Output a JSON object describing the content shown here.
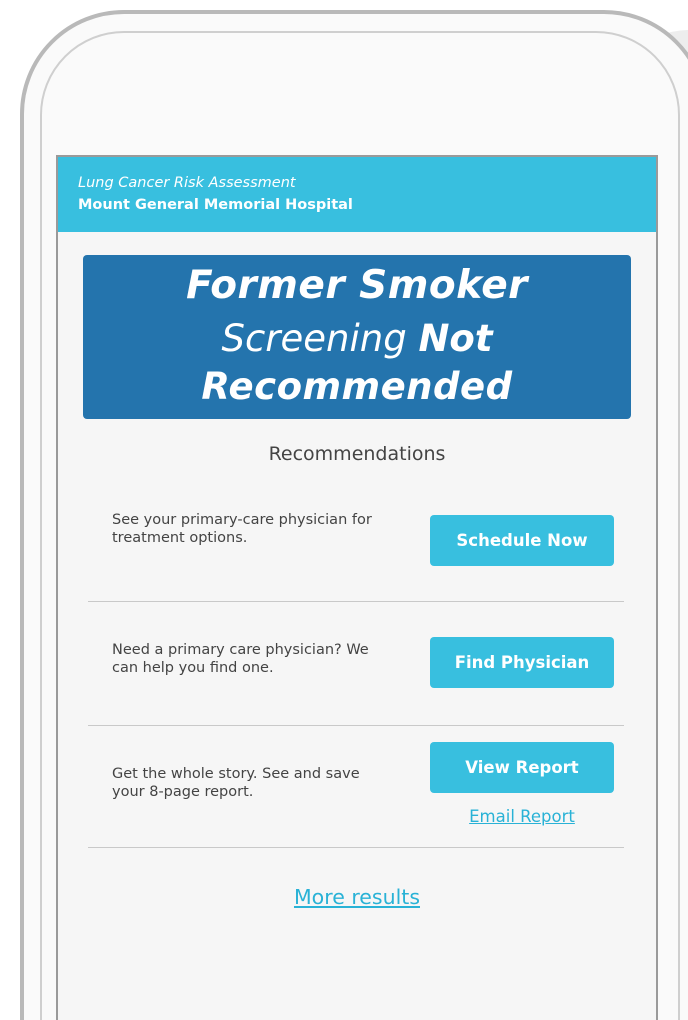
{
  "header": {
    "subtitle": "Lung Cancer Risk Assessment",
    "hospital": "Mount General Memorial Hospital"
  },
  "result": {
    "status": "Former Smoker",
    "line2_part1": "Screening",
    "line2_part2": "Not",
    "line3": "Recommended"
  },
  "recommendations": {
    "title": "Recommendations",
    "items": [
      {
        "text": "See your primary-care physician for treatment options.",
        "button": "Schedule Now"
      },
      {
        "text": "Need a primary care physician? We can help you find one.",
        "button": "Find Physician"
      },
      {
        "text": "Get the whole story. See and save your 8-page report.",
        "button": "View Report",
        "link": "Email Report"
      }
    ]
  },
  "more_results": "More results",
  "colors": {
    "header": "#38bfdf",
    "banner": "#2474ad",
    "button": "#38bfdf",
    "link": "#29b2d6"
  }
}
